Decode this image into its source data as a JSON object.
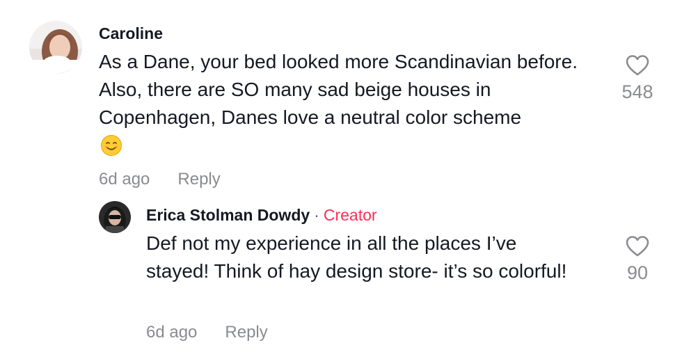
{
  "comments": [
    {
      "author": "Caroline",
      "text": "As a Dane, your bed looked more Scandinavian before. Also, there are SO many sad beige houses in Copenhagen, Danes love a neutral color scheme",
      "emoji_icon": "smiling-face-emoji",
      "time": "6d ago",
      "reply_label": "Reply",
      "likes": "548"
    }
  ],
  "replies": [
    {
      "author": "Erica Stolman Dowdy",
      "separator": "·",
      "badge": "Creator",
      "text": "Def not my experience in all the places I’ve stayed! Think of hay design store- it’s so colorful!",
      "time": "6d ago",
      "reply_label": "Reply",
      "likes": "90"
    }
  ],
  "colors": {
    "creator_badge": "#fe2c55",
    "meta_text": "#8a8b91",
    "primary_text": "#161823"
  }
}
